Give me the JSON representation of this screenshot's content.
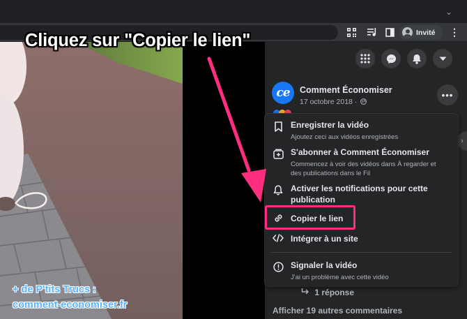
{
  "browser": {
    "profile_name": "Invité",
    "icons": [
      "qr-code-icon",
      "media-queue-icon",
      "side-panel-icon",
      "profile-icon",
      "menu-kebab-icon",
      "tab-list-icon"
    ]
  },
  "overlay": {
    "headline": "Cliquez sur \"Copier le lien\"",
    "watermark_line1": "+ de P'tits Trucs :",
    "watermark_line2": "comment-economiser.fr",
    "accent_color": "#ff2e7e",
    "watermark_color": "#5ab4ff"
  },
  "facebook": {
    "top_buttons": [
      "apps-grid-icon",
      "messenger-icon",
      "notifications-bell-icon",
      "account-dropdown-icon"
    ],
    "post": {
      "avatar_text": "ce",
      "author": "Comment Économiser",
      "date": "17 octobre 2018 ·",
      "privacy_icon": "globe-icon",
      "more_button": "•••"
    },
    "menu": {
      "items": [
        {
          "icon": "bookmark-icon",
          "label": "Enregistrer la vidéo",
          "sub": "Ajoutez ceci aux vidéos enregistrées"
        },
        {
          "icon": "subscribe-icon",
          "label": "S'abonner à Comment Économiser",
          "sub1": "Commencez à voir des vidéos dans À regarder et",
          "sub2": "des publications dans le Fil"
        },
        {
          "icon": "bell-icon",
          "label1": "Activer les notifications pour cette",
          "label2": "publication"
        },
        {
          "icon": "link-icon",
          "label": "Copier le lien"
        },
        {
          "icon": "code-icon",
          "label": "Intégrer à un site"
        },
        {
          "icon": "report-icon",
          "label": "Signaler la vidéo",
          "sub": "J'ai un problème avec cette vidéo"
        }
      ]
    },
    "reply_link": "1 réponse",
    "more_comments": "Afficher 19 autres commentaires"
  },
  "colors": {
    "panel_bg": "#242526",
    "fb_blue": "#1877f2",
    "text_primary": "#e4e6eb",
    "text_secondary": "#b0b3b8"
  }
}
